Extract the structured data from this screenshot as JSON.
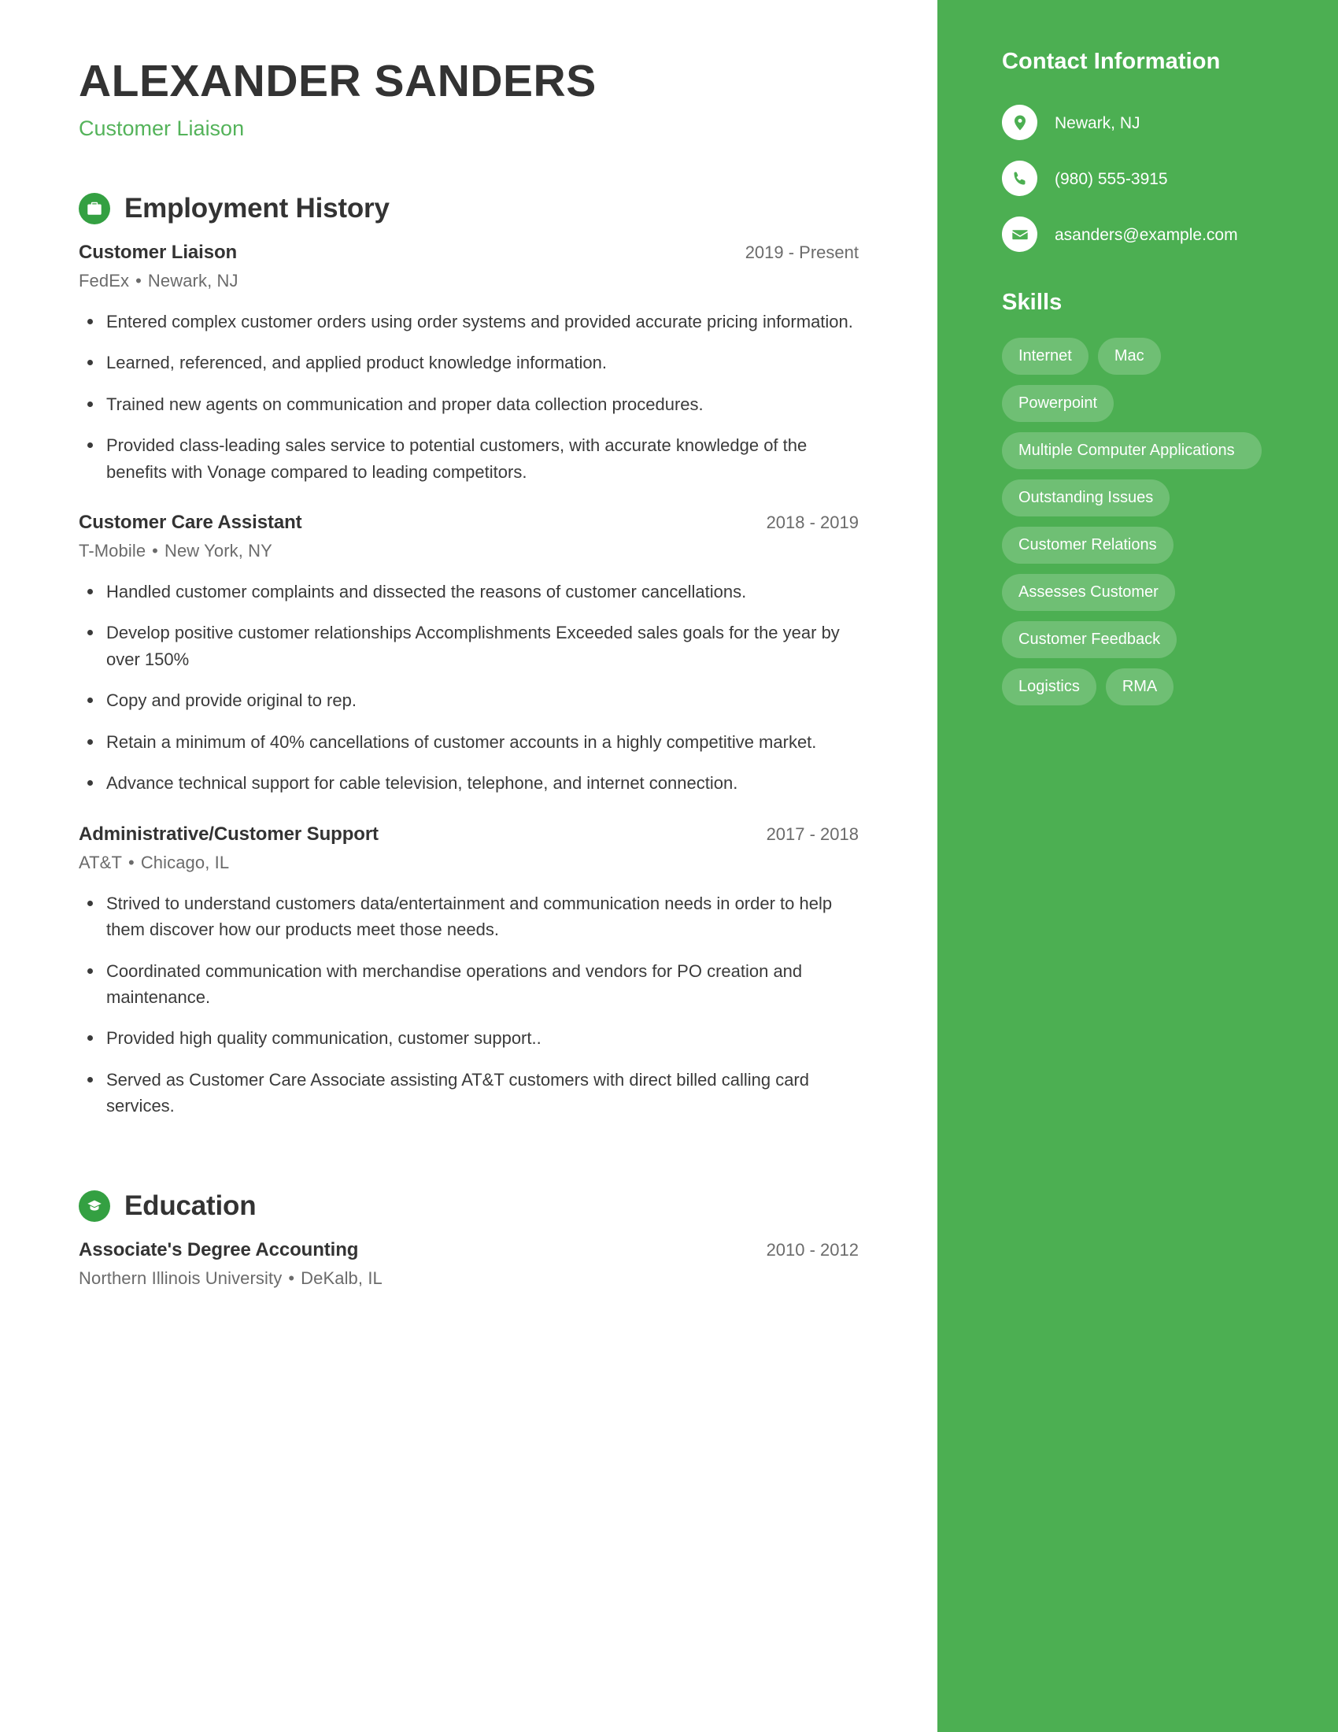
{
  "header": {
    "name": "ALEXANDER SANDERS",
    "title": "Customer Liaison"
  },
  "theme": {
    "sidebar_green": "#4caf52",
    "accent_green": "#54b35a",
    "icon_green": "#34a042",
    "text_dark": "#333333",
    "text_muted": "#6b6b6b"
  },
  "employment": {
    "section_title": "Employment History",
    "icon": "briefcase-icon",
    "entries": [
      {
        "role": "Customer Liaison",
        "dates": "2019 - Present",
        "company": "FedEx",
        "location": "Newark, NJ",
        "bullets": [
          "Entered complex customer orders using order systems and provided accurate pricing information.",
          "Learned, referenced, and applied product knowledge information.",
          "Trained new agents on communication and proper data collection procedures.",
          "Provided class-leading sales service to potential customers, with accurate knowledge of the benefits with Vonage compared to leading competitors."
        ]
      },
      {
        "role": "Customer Care Assistant",
        "dates": "2018 - 2019",
        "company": "T-Mobile",
        "location": "New York, NY",
        "bullets": [
          "Handled customer complaints and dissected the reasons of customer cancellations.",
          "Develop positive customer relationships Accomplishments Exceeded sales goals for the year by over 150%",
          "Copy and provide original to rep.",
          "Retain a minimum of 40% cancellations of customer accounts in a highly competitive market.",
          "Advance technical support for cable television, telephone, and internet connection."
        ]
      },
      {
        "role": "Administrative/Customer Support",
        "dates": "2017 - 2018",
        "company": "AT&T",
        "location": "Chicago, IL",
        "bullets": [
          "Strived to understand customers data/entertainment and communication needs in order to help them discover how our products meet those needs.",
          "Coordinated communication with merchandise operations and vendors for PO creation and maintenance.",
          "Provided high quality communication, customer support..",
          "Served as Customer Care Associate assisting AT&T customers with direct billed calling card services."
        ]
      }
    ]
  },
  "education": {
    "section_title": "Education",
    "icon": "graduation-cap-icon",
    "entries": [
      {
        "degree": "Associate's Degree Accounting",
        "dates": "2010 - 2012",
        "school": "Northern Illinois University",
        "location": "DeKalb, IL"
      }
    ]
  },
  "sidebar": {
    "contact": {
      "title": "Contact Information",
      "items": [
        {
          "icon": "location-pin-icon",
          "value": "Newark, NJ"
        },
        {
          "icon": "phone-icon",
          "value": "(980) 555-3915"
        },
        {
          "icon": "envelope-icon",
          "value": "asanders@example.com"
        }
      ]
    },
    "skills": {
      "title": "Skills",
      "items": [
        {
          "label": "Internet",
          "wide": false
        },
        {
          "label": "Mac",
          "wide": false
        },
        {
          "label": "Powerpoint",
          "wide": false
        },
        {
          "label": "Multiple Computer Applications",
          "wide": true
        },
        {
          "label": "Outstanding Issues",
          "wide": false
        },
        {
          "label": "Customer Relations",
          "wide": false
        },
        {
          "label": "Assesses Customer",
          "wide": false
        },
        {
          "label": "Customer Feedback",
          "wide": false
        },
        {
          "label": "Logistics",
          "wide": false
        },
        {
          "label": "RMA",
          "wide": false
        }
      ]
    }
  },
  "separator": "•"
}
